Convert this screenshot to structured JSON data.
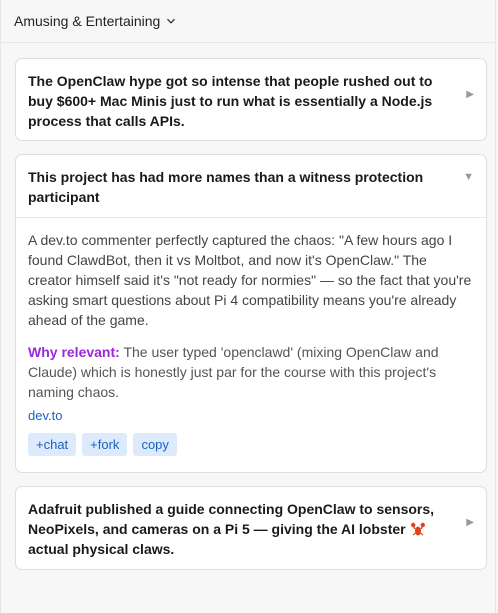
{
  "section": {
    "title": "Amusing & Entertaining",
    "chevron_icon": "chevron-down-icon"
  },
  "cards": [
    {
      "title": "The OpenClaw hype got so intense that people rushed out to buy $600+ Mac Minis just to run what is essentially a Node.js process that calls APIs.",
      "expanded": false
    },
    {
      "title": "This project has had more names than a witness protection participant",
      "expanded": true,
      "body": "A dev.to commenter perfectly captured the chaos: \"A few hours ago I found ClawdBot, then it vs Moltbot, and now it's OpenClaw.\" The creator himself said it's \"not ready for normies\" — so the fact that you're asking smart questions about Pi 4 compatibility means you're already ahead of the game.",
      "why_label": "Why relevant:",
      "why_text": "The user typed 'openclawd' (mixing OpenClaw and Claude) which is honestly just par for the course with this project's naming chaos.",
      "source": "dev.to",
      "actions": [
        "+chat",
        "+fork",
        "copy"
      ]
    },
    {
      "title": "Adafruit published a guide connecting OpenClaw to sensors, NeoPixels, and cameras on a Pi 5 — giving the AI lobster",
      "title_suffix": "actual physical claws.",
      "expanded": false,
      "emoji_icon": "lobster-icon"
    }
  ],
  "colors": {
    "accent_purple": "#9b27d6",
    "link_blue": "#1a62c2",
    "chip_bg": "#dceafc"
  }
}
